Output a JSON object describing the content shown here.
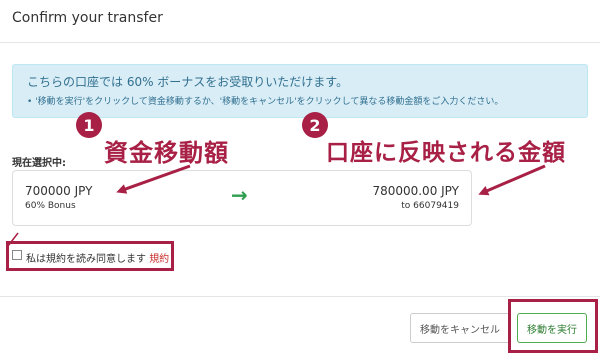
{
  "dialog": {
    "title": "Confirm your transfer"
  },
  "info": {
    "main": "こちらの口座では 60% ボーナスをお受取りいただけます。",
    "sub": "• '移動を実行'をクリックして資金移動するか、'移動をキャンセル'をクリックして異なる移動金額をご入力ください。"
  },
  "annotations": {
    "num1": "1",
    "label1": "資金移動額",
    "num2": "2",
    "label2": "口座に反映される金額"
  },
  "selection": {
    "label": "現在選択中:",
    "from_amount": "700000 JPY",
    "from_sub": "60% Bonus",
    "arrow": "→",
    "to_amount": "780000.00 JPY",
    "to_sub": "to 66079419"
  },
  "agreement": {
    "text": "私は規約を読み同意します",
    "link": "規約"
  },
  "buttons": {
    "cancel": "移動をキャンセル",
    "execute": "移動を実行"
  },
  "colors": {
    "annotation": "#a82045",
    "info_bg": "#d9edf7",
    "arrow_green": "#2e9e4f"
  }
}
